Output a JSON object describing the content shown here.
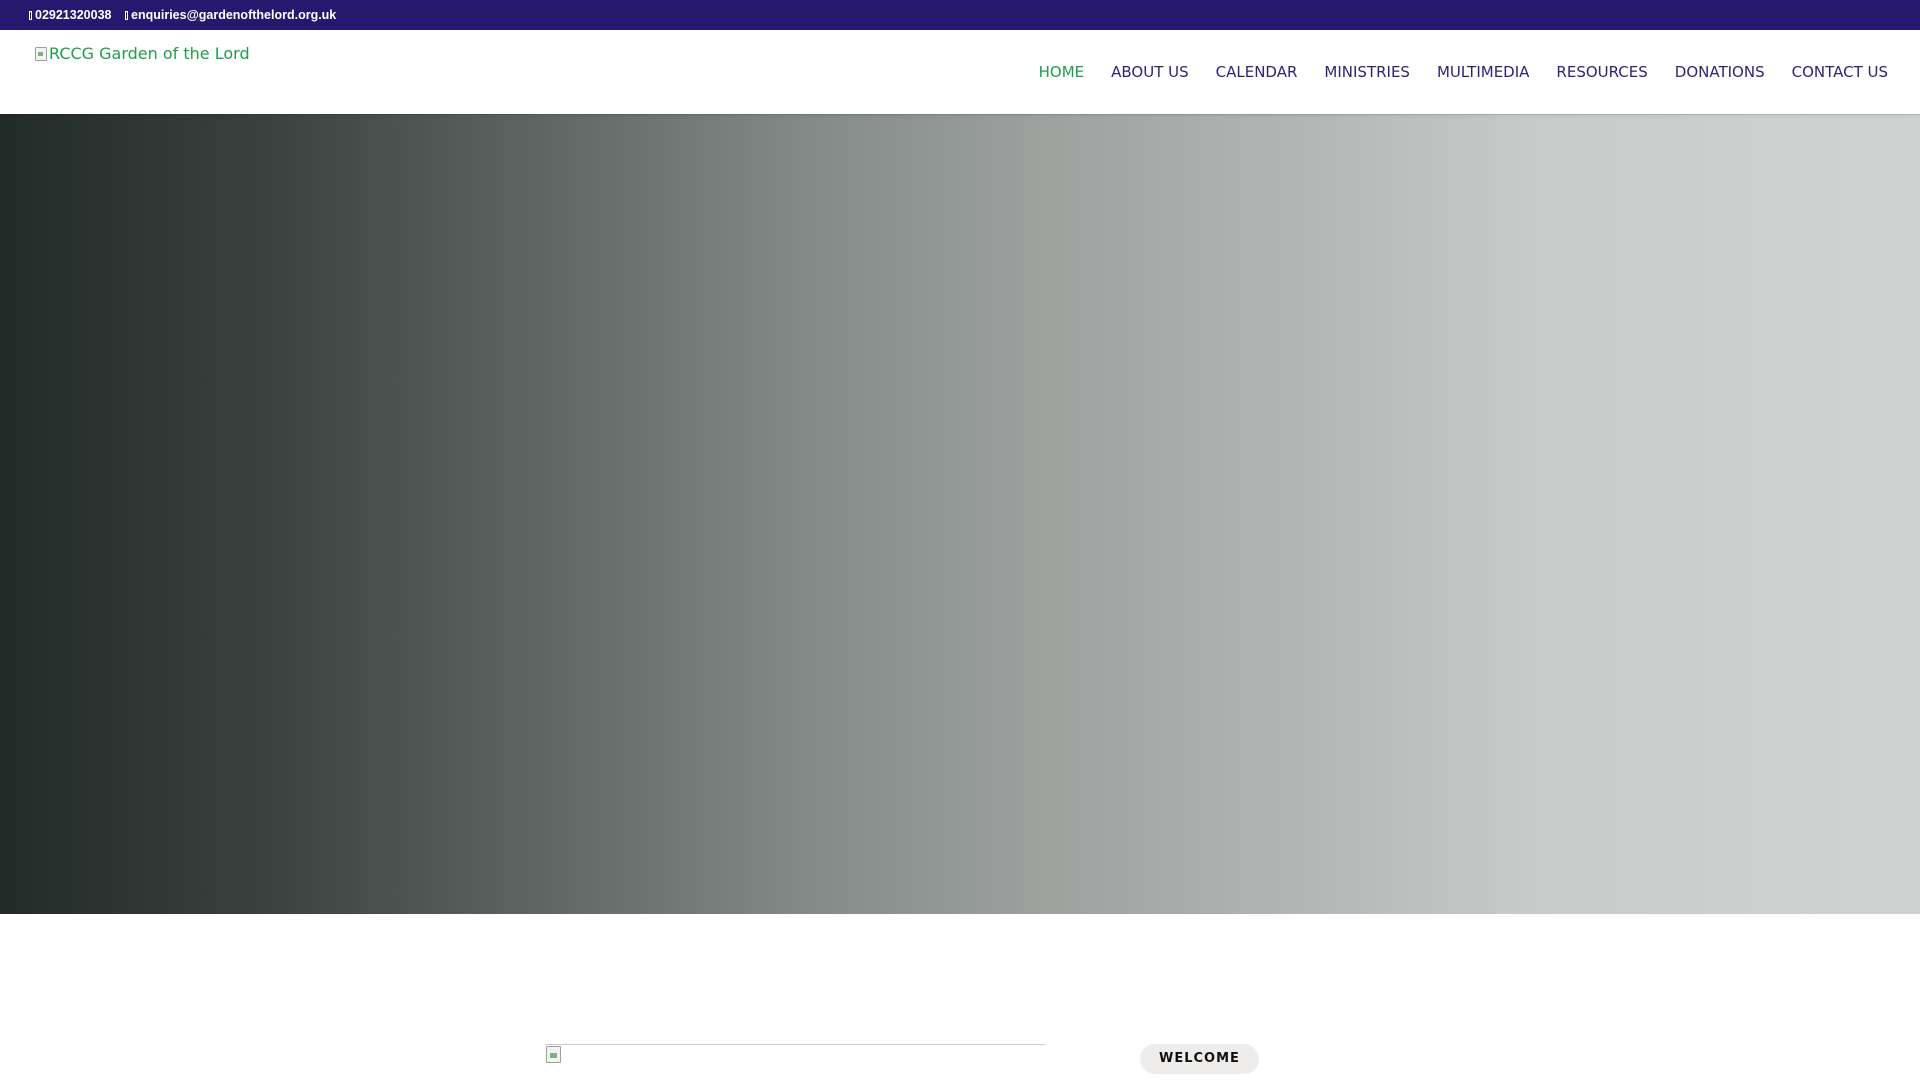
{
  "topbar": {
    "phone": "02921320038",
    "email": "enquiries@gardenofthelord.org.uk",
    "phone_icon": "phone-icon",
    "email_icon": "envelope-icon",
    "background": "#26186f"
  },
  "header": {
    "logo_alt": "RCCG Garden of the Lord",
    "nav": [
      {
        "label": "HOME",
        "active": true
      },
      {
        "label": "ABOUT US"
      },
      {
        "label": "CALENDAR"
      },
      {
        "label": "MINISTRIES"
      },
      {
        "label": "MULTIMEDIA"
      },
      {
        "label": "RESOURCES"
      },
      {
        "label": "DONATIONS"
      },
      {
        "label": "CONTACT US"
      }
    ],
    "colors": {
      "nav_text": "#2d2476",
      "nav_active": "#1e9e4a"
    }
  },
  "welcome": {
    "badge": "WELCOME"
  }
}
